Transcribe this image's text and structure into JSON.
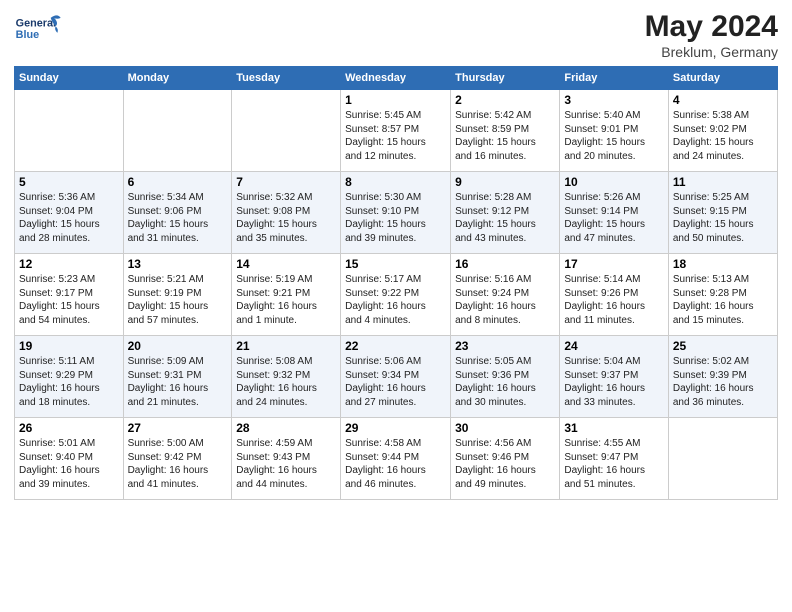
{
  "header": {
    "logo_general": "General",
    "logo_blue": "Blue",
    "month_year": "May 2024",
    "location": "Breklum, Germany"
  },
  "days_of_week": [
    "Sunday",
    "Monday",
    "Tuesday",
    "Wednesday",
    "Thursday",
    "Friday",
    "Saturday"
  ],
  "weeks": [
    [
      {
        "day": "",
        "info": ""
      },
      {
        "day": "",
        "info": ""
      },
      {
        "day": "",
        "info": ""
      },
      {
        "day": "1",
        "info": "Sunrise: 5:45 AM\nSunset: 8:57 PM\nDaylight: 15 hours\nand 12 minutes."
      },
      {
        "day": "2",
        "info": "Sunrise: 5:42 AM\nSunset: 8:59 PM\nDaylight: 15 hours\nand 16 minutes."
      },
      {
        "day": "3",
        "info": "Sunrise: 5:40 AM\nSunset: 9:01 PM\nDaylight: 15 hours\nand 20 minutes."
      },
      {
        "day": "4",
        "info": "Sunrise: 5:38 AM\nSunset: 9:02 PM\nDaylight: 15 hours\nand 24 minutes."
      }
    ],
    [
      {
        "day": "5",
        "info": "Sunrise: 5:36 AM\nSunset: 9:04 PM\nDaylight: 15 hours\nand 28 minutes."
      },
      {
        "day": "6",
        "info": "Sunrise: 5:34 AM\nSunset: 9:06 PM\nDaylight: 15 hours\nand 31 minutes."
      },
      {
        "day": "7",
        "info": "Sunrise: 5:32 AM\nSunset: 9:08 PM\nDaylight: 15 hours\nand 35 minutes."
      },
      {
        "day": "8",
        "info": "Sunrise: 5:30 AM\nSunset: 9:10 PM\nDaylight: 15 hours\nand 39 minutes."
      },
      {
        "day": "9",
        "info": "Sunrise: 5:28 AM\nSunset: 9:12 PM\nDaylight: 15 hours\nand 43 minutes."
      },
      {
        "day": "10",
        "info": "Sunrise: 5:26 AM\nSunset: 9:14 PM\nDaylight: 15 hours\nand 47 minutes."
      },
      {
        "day": "11",
        "info": "Sunrise: 5:25 AM\nSunset: 9:15 PM\nDaylight: 15 hours\nand 50 minutes."
      }
    ],
    [
      {
        "day": "12",
        "info": "Sunrise: 5:23 AM\nSunset: 9:17 PM\nDaylight: 15 hours\nand 54 minutes."
      },
      {
        "day": "13",
        "info": "Sunrise: 5:21 AM\nSunset: 9:19 PM\nDaylight: 15 hours\nand 57 minutes."
      },
      {
        "day": "14",
        "info": "Sunrise: 5:19 AM\nSunset: 9:21 PM\nDaylight: 16 hours\nand 1 minute."
      },
      {
        "day": "15",
        "info": "Sunrise: 5:17 AM\nSunset: 9:22 PM\nDaylight: 16 hours\nand 4 minutes."
      },
      {
        "day": "16",
        "info": "Sunrise: 5:16 AM\nSunset: 9:24 PM\nDaylight: 16 hours\nand 8 minutes."
      },
      {
        "day": "17",
        "info": "Sunrise: 5:14 AM\nSunset: 9:26 PM\nDaylight: 16 hours\nand 11 minutes."
      },
      {
        "day": "18",
        "info": "Sunrise: 5:13 AM\nSunset: 9:28 PM\nDaylight: 16 hours\nand 15 minutes."
      }
    ],
    [
      {
        "day": "19",
        "info": "Sunrise: 5:11 AM\nSunset: 9:29 PM\nDaylight: 16 hours\nand 18 minutes."
      },
      {
        "day": "20",
        "info": "Sunrise: 5:09 AM\nSunset: 9:31 PM\nDaylight: 16 hours\nand 21 minutes."
      },
      {
        "day": "21",
        "info": "Sunrise: 5:08 AM\nSunset: 9:32 PM\nDaylight: 16 hours\nand 24 minutes."
      },
      {
        "day": "22",
        "info": "Sunrise: 5:06 AM\nSunset: 9:34 PM\nDaylight: 16 hours\nand 27 minutes."
      },
      {
        "day": "23",
        "info": "Sunrise: 5:05 AM\nSunset: 9:36 PM\nDaylight: 16 hours\nand 30 minutes."
      },
      {
        "day": "24",
        "info": "Sunrise: 5:04 AM\nSunset: 9:37 PM\nDaylight: 16 hours\nand 33 minutes."
      },
      {
        "day": "25",
        "info": "Sunrise: 5:02 AM\nSunset: 9:39 PM\nDaylight: 16 hours\nand 36 minutes."
      }
    ],
    [
      {
        "day": "26",
        "info": "Sunrise: 5:01 AM\nSunset: 9:40 PM\nDaylight: 16 hours\nand 39 minutes."
      },
      {
        "day": "27",
        "info": "Sunrise: 5:00 AM\nSunset: 9:42 PM\nDaylight: 16 hours\nand 41 minutes."
      },
      {
        "day": "28",
        "info": "Sunrise: 4:59 AM\nSunset: 9:43 PM\nDaylight: 16 hours\nand 44 minutes."
      },
      {
        "day": "29",
        "info": "Sunrise: 4:58 AM\nSunset: 9:44 PM\nDaylight: 16 hours\nand 46 minutes."
      },
      {
        "day": "30",
        "info": "Sunrise: 4:56 AM\nSunset: 9:46 PM\nDaylight: 16 hours\nand 49 minutes."
      },
      {
        "day": "31",
        "info": "Sunrise: 4:55 AM\nSunset: 9:47 PM\nDaylight: 16 hours\nand 51 minutes."
      },
      {
        "day": "",
        "info": ""
      }
    ]
  ]
}
